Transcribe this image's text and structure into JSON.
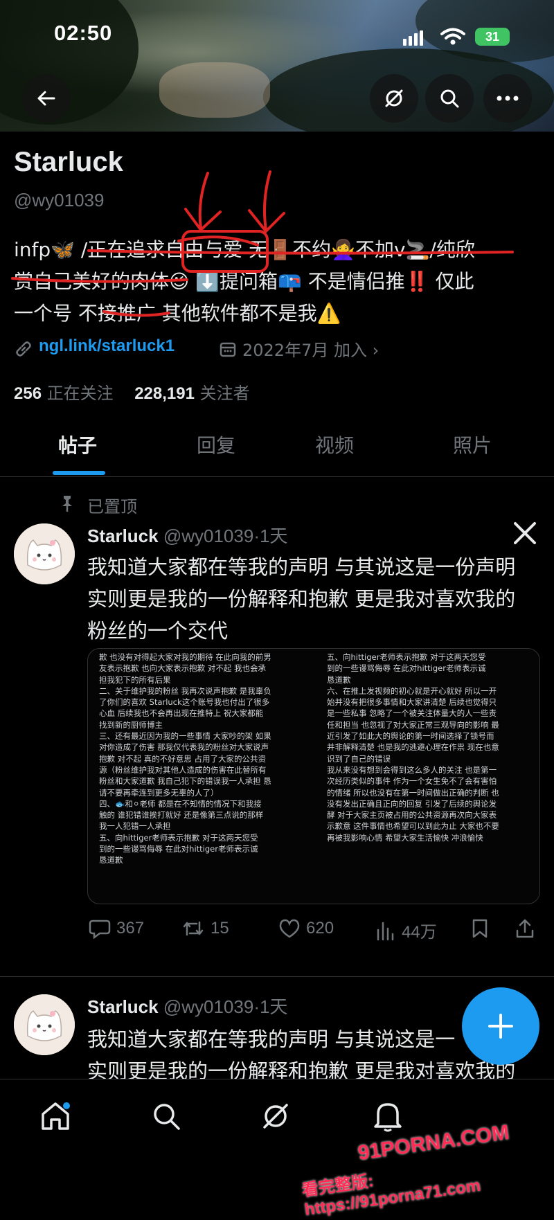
{
  "status_bar": {
    "time": "02:50",
    "battery": "31"
  },
  "profile": {
    "name": "Starluck",
    "handle": "@wy01039",
    "bio_line1": "infp🦋 /正在追求自由与爱 无🚪不约🙅‍♀️不加v🚬/纯欣",
    "bio_line2": "赏自己美好的肉体😉 ⬇️提问箱📪 不是情侣推‼️ 仅此",
    "bio_line3": "一个号 不接推广 其他软件都不是我⚠️",
    "link": "ngl.link/starluck1",
    "joined": "2022年7月 加入 ›",
    "following_count": "256",
    "following_label": "正在关注",
    "followers_count": "228,191",
    "followers_label": "关注者"
  },
  "tabs": [
    "帖子",
    "回复",
    "视频",
    "照片"
  ],
  "pinned_label": "已置顶",
  "post": {
    "author": "Starluck",
    "meta": "@wy01039·1天",
    "text_line1": "我知道大家都在等我的声明 与其说这是一份声明",
    "text_line2": "实则更是我的一份解释和抱歉 更是我对喜欢我的",
    "text_line3": "粉丝的一个交代",
    "doc_left": [
      "歉 也没有对得起大家对我的期待 在此向我的前男",
      "友表示抱歉 也向大家表示抱歉 对不起 我也会承",
      "担我犯下的所有后果",
      "二、关于维护我的粉丝 我再次说声抱歉 是我辜负",
      "了你们的喜欢 Starluck这个账号我也付出了很多",
      "心血 后续我也不会再出现在推特上 祝大家都能",
      "找到新的厨师博主",
      "三、还有最近因为我的一些事情 大家吵的架 如果",
      "对你造成了伤害 那我仅代表我的粉丝对大家说声",
      "抱歉 对不起 真的不好意思 占用了大家的公共资",
      "源（粉丝维护我对其他人造成的伤害在此替所有",
      "粉丝和大家道歉 我自己犯下的错误我一人承担 恳",
      "请不要再牵连到更多无辜的人了）",
      "四、🐟和⚪老师 都是在不知情的情况下和我接",
      "触的 谁犯错谁挨打就好 还是像第三点说的那样",
      "我一人犯错一人承担",
      "五、向hittiger老师表示抱歉 对于这两天您受",
      "到的一些谩骂侮辱 在此对hittiger老师表示诚",
      "恳道歉"
    ],
    "doc_right": [
      "五、向hittiger老师表示抱歉 对于这两天您受",
      "到的一些谩骂侮辱 在此对hittiger老师表示诚",
      "恳道歉",
      "六、在推上发视频的初心就是开心就好 所以一开",
      "始并没有把很多事情和大家讲清楚 后续也觉得只",
      "是一些私事 忽略了一个被关注体量大的人一些责",
      "任和担当 也忽视了对大家正常三观导向的影响 最",
      "近引发了如此大的舆论的第一时间选择了锁号而",
      "并非解释清楚 也是我的逃避心理在作祟 现在也意",
      "识到了自己的错误",
      "我从来没有想到会得到这么多人的关注 也是第一",
      "次经历类似的事件 作为一个女生免不了会有害怕",
      "的情绪 所以也没有在第一时间做出正确的判断 也",
      "没有发出正确且正向的回复 引发了后续的舆论发",
      "酵 对于大家主页被占用的公共资源再次向大家表",
      "示歉意 这件事情也希望可以到此为止 大家也不要",
      "再被我影响心情 希望大家生活愉快 冲浪愉快"
    ],
    "replies": "367",
    "reposts": "15",
    "likes": "620",
    "views": "44万"
  },
  "post2": {
    "author": "Starluck",
    "meta": "@wy01039·1天",
    "text_line1": "我知道大家都在等我的声明 与其说这是一",
    "text_line2": "实则更是我的一份解释和抱歉 更是我对喜欢我的"
  },
  "watermark": {
    "line1": "91PORNA.COM",
    "line2": "看完整版: https://91porna71.com"
  },
  "colors": {
    "accent": "#1d9bf0",
    "background": "#000000",
    "text": "#e7e9ea",
    "muted": "#71767b",
    "annotation_red": "#e02424"
  },
  "icons": [
    "back-arrow-icon",
    "grok-icon",
    "search-icon",
    "more-icon",
    "x-logo-icon",
    "reply-icon",
    "repost-icon",
    "like-icon",
    "views-icon",
    "bookmark-icon",
    "share-icon",
    "pin-icon",
    "link-icon",
    "calendar-icon",
    "home-icon",
    "notification-icon",
    "plus-icon"
  ]
}
